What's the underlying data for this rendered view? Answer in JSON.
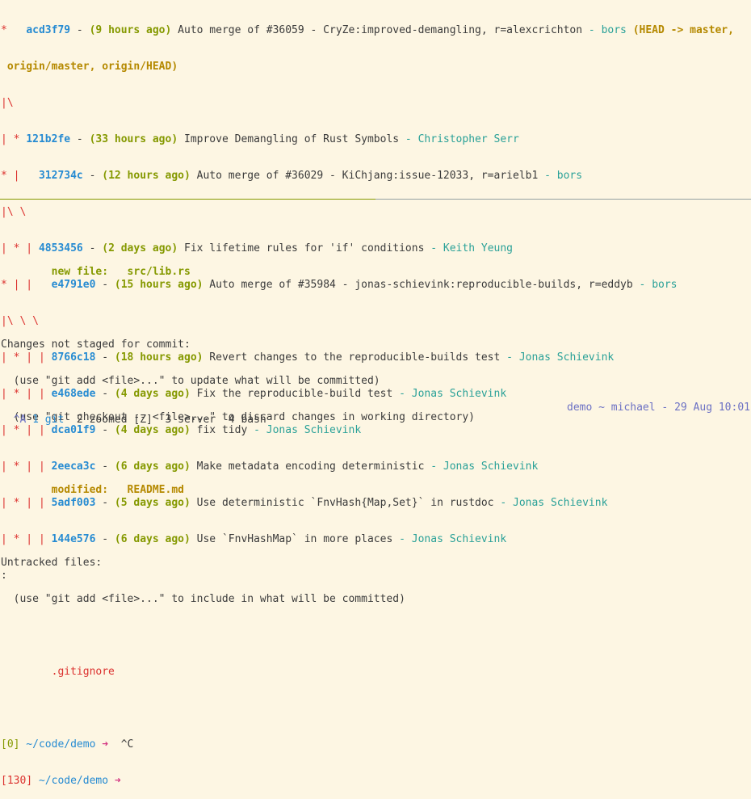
{
  "top_pane": {
    "log": [
      {
        "graph": "*   ",
        "hash": "acd3f79",
        "sep": " - ",
        "date": "(9 hours ago)",
        "msg": " Auto merge of #36059 - CryZe:improved-demangling, r=alexcrichton",
        "dash": " - ",
        "author": "bors",
        "refs": " (HEAD -> master,"
      },
      {
        "graph": "",
        "cont": " origin/master, origin/HEAD)"
      },
      {
        "graph": "|\\"
      },
      {
        "graph": "| * ",
        "hash": "121b2fe",
        "sep": " - ",
        "date": "(33 hours ago)",
        "msg": " Improve Demangling of Rust Symbols",
        "dash": " - ",
        "author": "Christopher Serr"
      },
      {
        "graph": "* |   ",
        "hash": "312734c",
        "sep": " - ",
        "date": "(12 hours ago)",
        "msg": " Auto merge of #36029 - KiChjang:issue-12033, r=arielb1",
        "dash": " - ",
        "author": "bors"
      },
      {
        "graph": "|\\ \\"
      },
      {
        "graph": "| * | ",
        "hash": "4853456",
        "sep": " - ",
        "date": "(2 days ago)",
        "msg": " Fix lifetime rules for 'if' conditions",
        "dash": " - ",
        "author": "Keith Yeung"
      },
      {
        "graph": "* | |   ",
        "hash": "e4791e0",
        "sep": " - ",
        "date": "(15 hours ago)",
        "msg": " Auto merge of #35984 - jonas-schievink:reproducible-builds, r=eddyb",
        "dash": " - ",
        "author": "bors"
      },
      {
        "graph": "|\\ \\ \\"
      },
      {
        "graph": "| * | | ",
        "hash": "8766c18",
        "sep": " - ",
        "date": "(18 hours ago)",
        "msg": " Revert changes to the reproducible-builds test",
        "dash": " - ",
        "author": "Jonas Schievink"
      },
      {
        "graph": "| * | | ",
        "hash": "e468ede",
        "sep": " - ",
        "date": "(4 days ago)",
        "msg": " Fix the reproducible-build test",
        "dash": " - ",
        "author": "Jonas Schievink"
      },
      {
        "graph": "| * | | ",
        "hash": "dca01f9",
        "sep": " - ",
        "date": "(4 days ago)",
        "msg": " fix tidy",
        "dash": " - ",
        "author": "Jonas Schievink"
      },
      {
        "graph": "| * | | ",
        "hash": "2eeca3c",
        "sep": " - ",
        "date": "(6 days ago)",
        "msg": " Make metadata encoding deterministic",
        "dash": " - ",
        "author": "Jonas Schievink"
      },
      {
        "graph": "| * | | ",
        "hash": "5adf003",
        "sep": " - ",
        "date": "(5 days ago)",
        "msg": " Use deterministic `FnvHash{Map,Set}` in rustdoc",
        "dash": " - ",
        "author": "Jonas Schievink"
      },
      {
        "graph": "| * | | ",
        "hash": "144e576",
        "sep": " - ",
        "date": "(6 days ago)",
        "msg": " Use `FnvHashMap` in more places",
        "dash": " - ",
        "author": "Jonas Schievink"
      }
    ],
    "pager_prompt": ":"
  },
  "bottom_pane": {
    "new_file_label": "        new file:   ",
    "new_file_path": "src/lib.rs",
    "not_staged_header": "Changes not staged for commit:",
    "not_staged_hint1": "  (use \"git add <file>...\" to update what will be committed)",
    "not_staged_hint2": "  (use \"git checkout -- <file>...\" to discard changes in working directory)",
    "modified_label": "        modified:   ",
    "modified_path": "README.md",
    "untracked_header": "Untracked files:",
    "untracked_hint": "  (use \"git add <file>...\" to include in what will be committed)",
    "untracked_file": "        .gitignore",
    "prompt1_code": "[0]",
    "prompt1_path": " ~/code/demo",
    "prompt1_arrow": " ➜",
    "prompt1_input": "  ^C",
    "prompt2_code": "[130]",
    "prompt2_path": " ~/code/demo",
    "prompt2_arrow": " ➜"
  },
  "statusbar": {
    "prefix": "^A",
    "window1": " 1 git",
    "window2": "  2 zoomed [Z]",
    "window3": "  3 server",
    "window4": "  4 bash",
    "right": "demo ~ michael - 29 Aug 10:01"
  }
}
